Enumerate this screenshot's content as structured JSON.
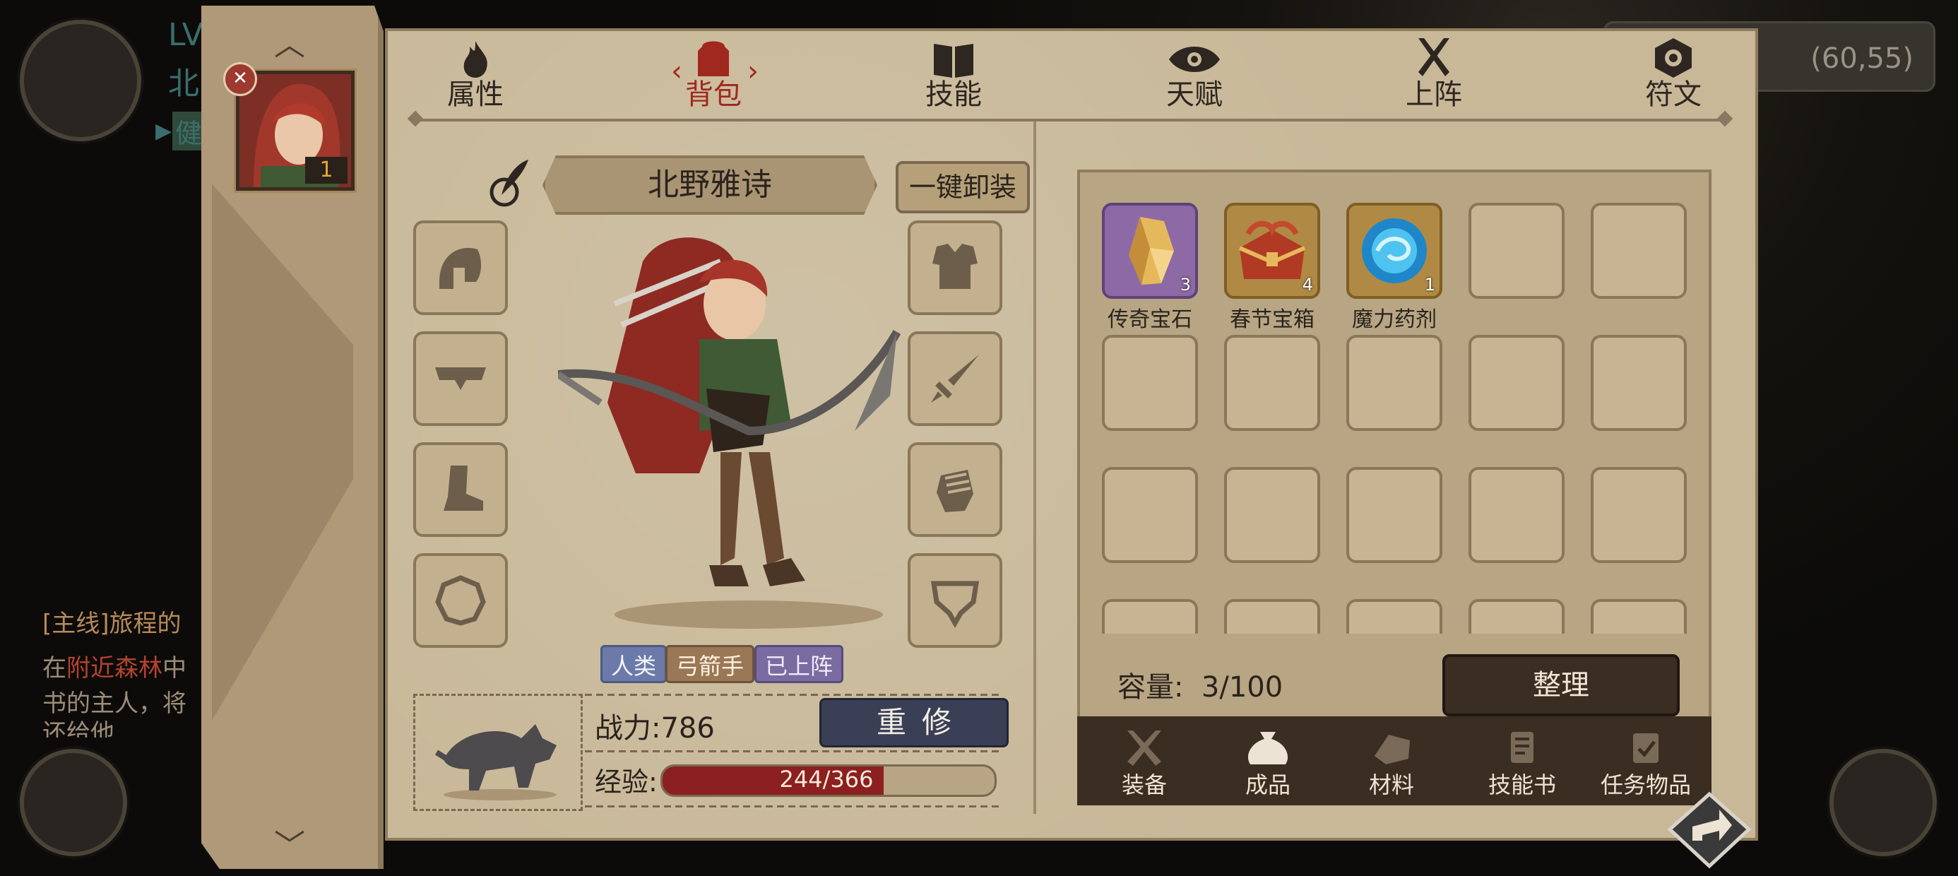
{
  "background": {
    "level_prefix": "LV",
    "name_fragment": "北",
    "status_fragment": "健",
    "quest_title": "[主线]旅程的",
    "quest_lines": [
      {
        "before": "在",
        "highlight": "附近森林",
        "after": "中"
      },
      {
        "before": "书的主人，将",
        "highlight": "",
        "after": ""
      },
      {
        "before": "还给他",
        "highlight": "",
        "after": ""
      }
    ],
    "coordinates": "(60,55)"
  },
  "hero_list": {
    "level": "1"
  },
  "tabs": [
    {
      "label": "属性",
      "icon": "flame-icon",
      "active": false
    },
    {
      "label": "背包",
      "icon": "backpack-icon",
      "active": true
    },
    {
      "label": "技能",
      "icon": "book-icon",
      "active": false
    },
    {
      "label": "天赋",
      "icon": "eye-icon",
      "active": false
    },
    {
      "label": "上阵",
      "icon": "crossed-swords-icon",
      "active": false
    },
    {
      "label": "符文",
      "icon": "rune-icon",
      "active": false
    }
  ],
  "character": {
    "name": "北野雅诗",
    "unequip_all_label": "一键卸装",
    "tags": [
      "人类",
      "弓箭手",
      "已上阵"
    ],
    "power_label": "战力:786",
    "repair_label": "重修",
    "exp_label": "经验:",
    "exp_text": "244/366",
    "exp_current": 244,
    "exp_max": 366
  },
  "equipment_slots": {
    "left": [
      "helmet-icon",
      "belt-icon",
      "boots-icon",
      "ring-icon"
    ],
    "right": [
      "armor-icon",
      "weapon-icon",
      "gloves-icon",
      "necklace-icon"
    ]
  },
  "inventory": {
    "items": [
      {
        "name": "传奇宝石",
        "count": "3",
        "quality": "purple",
        "icon": "legendary-gem-icon"
      },
      {
        "name": "春节宝箱",
        "count": "4",
        "quality": "gold",
        "icon": "festival-chest-icon"
      },
      {
        "name": "魔力药剂",
        "count": "1",
        "quality": "gold",
        "icon": "mana-potion-icon"
      }
    ],
    "capacity_label": "容量:",
    "capacity_value": "3/100",
    "sort_label": "整理"
  },
  "bottom_tabs": [
    {
      "label": "装备",
      "icon": "equipment-icon"
    },
    {
      "label": "成品",
      "icon": "pouch-icon"
    },
    {
      "label": "材料",
      "icon": "ore-icon"
    },
    {
      "label": "技能书",
      "icon": "scroll-icon"
    },
    {
      "label": "任务物品",
      "icon": "quest-scroll-icon"
    }
  ],
  "colors": {
    "active_tab": "#a0281e",
    "panel": "#c8b898",
    "exp_fill": "#8c1f1f",
    "repair_button": "#3a3f55",
    "sort_button": "#3a2e22"
  }
}
